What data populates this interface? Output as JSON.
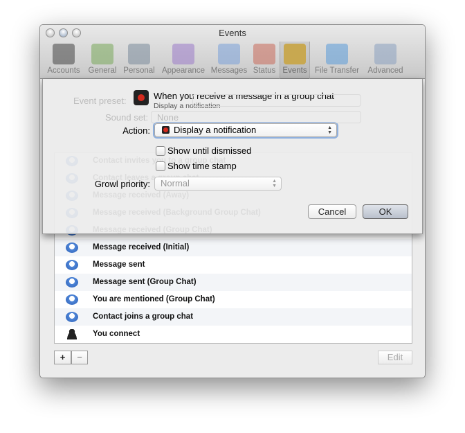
{
  "window": {
    "title": "Events"
  },
  "toolbar": [
    {
      "label": "Accounts",
      "icon": "accounts-icon",
      "color": "#444444"
    },
    {
      "label": "General",
      "icon": "general-icon",
      "color": "#79a85a"
    },
    {
      "label": "Personal",
      "icon": "personal-icon",
      "color": "#7a8a9a"
    },
    {
      "label": "Appearance",
      "icon": "appearance-icon",
      "color": "#9a7ac8"
    },
    {
      "label": "Messages",
      "icon": "messages-icon",
      "color": "#7aa0d8"
    },
    {
      "label": "Status",
      "icon": "status-icon",
      "color": "#c86a5a"
    },
    {
      "label": "Events",
      "icon": "bell-icon",
      "color": "#c8a850",
      "selected": true
    },
    {
      "label": "File Transfer",
      "icon": "file-transfer-icon",
      "color": "#5a9ad8"
    },
    {
      "label": "Advanced",
      "icon": "gear-icon",
      "color": "#8aa0c0"
    }
  ],
  "background": {
    "event_preset_label": "Event preset:",
    "sound_set_label": "Sound set:",
    "sound_set_value": "None"
  },
  "events": [
    {
      "label": "Contact invites you to a group chat",
      "icon": "chat-bubble-icon"
    },
    {
      "label": "Contact leaves a group chat",
      "icon": "chat-bubble-icon"
    },
    {
      "label": "Message received (Away)",
      "icon": "chat-bubble-icon"
    },
    {
      "label": "Message received (Background Group Chat)",
      "icon": "chat-bubble-icon"
    },
    {
      "label": "Message received (Group Chat)",
      "icon": "chat-bubble-icon"
    },
    {
      "label": "Message received (Initial)",
      "icon": "chat-bubble-icon"
    },
    {
      "label": "Message sent",
      "icon": "chat-bubble-icon"
    },
    {
      "label": "Message sent (Group Chat)",
      "icon": "chat-bubble-icon"
    },
    {
      "label": "You are mentioned (Group Chat)",
      "icon": "chat-bubble-icon"
    },
    {
      "label": "Contact joins a group chat",
      "icon": "chat-bubble-icon"
    },
    {
      "label": "You connect",
      "icon": "person-icon"
    }
  ],
  "list_buttons": {
    "add": "+",
    "remove": "−",
    "edit": "Edit"
  },
  "sheet": {
    "title": "When you receive a message in a group chat",
    "subtitle": "Display a notification",
    "action_label": "Action:",
    "action_value": "Display a notification",
    "show_until_dismissed": {
      "label": "Show until dismissed",
      "checked": false
    },
    "show_time_stamp": {
      "label": "Show time stamp",
      "checked": false
    },
    "growl_priority_label": "Growl priority:",
    "growl_priority_value": "Normal",
    "cancel": "Cancel",
    "ok": "OK"
  }
}
